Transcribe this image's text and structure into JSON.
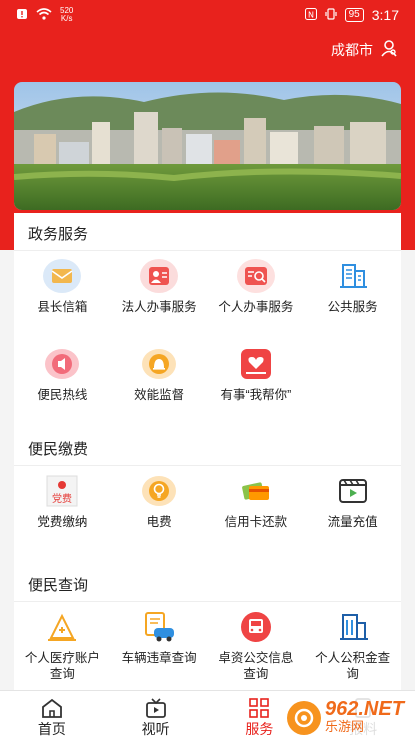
{
  "status": {
    "speed_value": "520",
    "speed_unit": "K/s",
    "battery": "95",
    "time": "3:17"
  },
  "header": {
    "city": "成都市"
  },
  "sections": [
    {
      "title": "政务服务",
      "items": [
        {
          "label": "县长信箱",
          "icon": "mailbox-icon"
        },
        {
          "label": "法人办事服务",
          "icon": "legal-person-icon"
        },
        {
          "label": "个人办事服务",
          "icon": "personal-affairs-icon"
        },
        {
          "label": "公共服务",
          "icon": "building-icon"
        },
        {
          "label": "便民热线",
          "icon": "hotline-icon"
        },
        {
          "label": "效能监督",
          "icon": "bell-icon"
        },
        {
          "label": "有事“我帮你”",
          "icon": "heart-hand-icon"
        }
      ]
    },
    {
      "title": "便民缴费",
      "items": [
        {
          "label": "党费缴纳",
          "icon": "party-fee-icon",
          "badge": "党费"
        },
        {
          "label": "电费",
          "icon": "bulb-icon"
        },
        {
          "label": "信用卡还款",
          "icon": "credit-card-icon"
        },
        {
          "label": "流量充值",
          "icon": "video-data-icon"
        }
      ]
    },
    {
      "title": "便民查询",
      "items": [
        {
          "label": "个人医疗账户查询",
          "icon": "medical-icon"
        },
        {
          "label": "车辆违章查询",
          "icon": "car-violation-icon"
        },
        {
          "label": "卓资公交信息查询",
          "icon": "bus-icon"
        },
        {
          "label": "个人公积金查询",
          "icon": "fund-icon"
        }
      ]
    }
  ],
  "nav": [
    {
      "label": "首页",
      "icon": "home-icon"
    },
    {
      "label": "视听",
      "icon": "video-icon"
    },
    {
      "label": "服务",
      "icon": "grid-icon",
      "active": true
    },
    {
      "label": "报料",
      "icon": "report-icon"
    }
  ],
  "watermark": {
    "brand": "962.NET",
    "sub": "乐游网"
  },
  "colors": {
    "brand_red": "#e8221d",
    "icon_blue": "#2f8fe0",
    "icon_orange": "#f5a623"
  }
}
